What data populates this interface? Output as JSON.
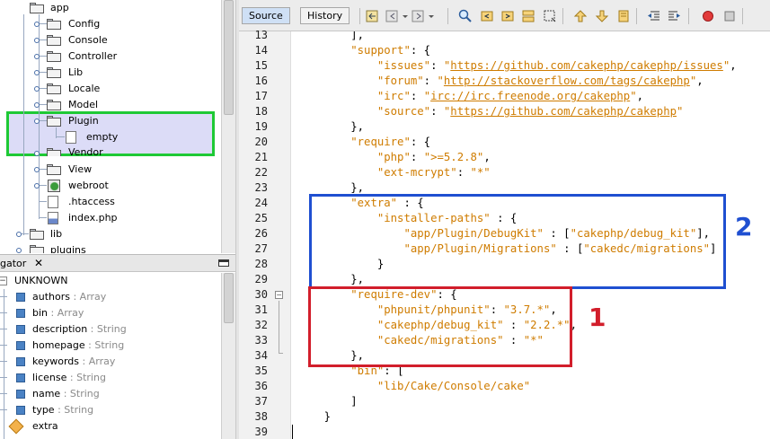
{
  "project_tree": {
    "items": [
      {
        "label": "app",
        "kind": "folder"
      },
      {
        "label": "Config",
        "kind": "folder"
      },
      {
        "label": "Console",
        "kind": "folder"
      },
      {
        "label": "Controller",
        "kind": "folder"
      },
      {
        "label": "Lib",
        "kind": "folder"
      },
      {
        "label": "Locale",
        "kind": "folder"
      },
      {
        "label": "Model",
        "kind": "folder"
      },
      {
        "label": "Plugin",
        "kind": "folder"
      },
      {
        "label": "empty",
        "kind": "file"
      },
      {
        "label": "Vendor",
        "kind": "folder"
      },
      {
        "label": "View",
        "kind": "folder"
      },
      {
        "label": "webroot",
        "kind": "folder"
      },
      {
        "label": ".htaccess",
        "kind": "file"
      },
      {
        "label": "index.php",
        "kind": "php-file"
      },
      {
        "label": "lib",
        "kind": "folder"
      },
      {
        "label": "plugins",
        "kind": "folder"
      }
    ]
  },
  "navigator": {
    "tab_label": "gator",
    "close_glyph": "✕",
    "root_label": "UNKNOWN",
    "items": [
      {
        "name": "authors",
        "type": " : Array"
      },
      {
        "name": "bin",
        "type": " : Array"
      },
      {
        "name": "description",
        "type": " : String"
      },
      {
        "name": "homepage",
        "type": " : String"
      },
      {
        "name": "keywords",
        "type": " : Array"
      },
      {
        "name": "license",
        "type": " : String"
      },
      {
        "name": "name",
        "type": " : String"
      },
      {
        "name": "type",
        "type": " : String"
      },
      {
        "name": "extra",
        "type": ""
      }
    ]
  },
  "editor": {
    "tabs": {
      "source": "Source",
      "history": "History"
    },
    "line_numbers": [
      "13",
      "14",
      "15",
      "16",
      "17",
      "18",
      "19",
      "20",
      "21",
      "22",
      "23",
      "24",
      "25",
      "26",
      "27",
      "28",
      "29",
      "30",
      "31",
      "32",
      "33",
      "34",
      "35",
      "36",
      "37",
      "38",
      "39"
    ],
    "lines": [
      "        ],",
      "        \"support\": {",
      "            \"issues\": \"https://github.com/cakephp/cakephp/issues\",",
      "            \"forum\": \"http://stackoverflow.com/tags/cakephp\",",
      "            \"irc\": \"irc://irc.freenode.org/cakephp\",",
      "            \"source\": \"https://github.com/cakephp/cakephp\"",
      "        },",
      "        \"require\": {",
      "            \"php\": \">=5.2.8\",",
      "            \"ext-mcrypt\": \"*\"",
      "        },",
      "        \"extra\" : {",
      "            \"installer-paths\" : {",
      "                \"app/Plugin/DebugKit\" : [\"cakephp/debug_kit\"],",
      "                \"app/Plugin/Migrations\" : [\"cakedc/migrations\"]",
      "            }",
      "        },",
      "        \"require-dev\": {",
      "            \"phpunit/phpunit\": \"3.7.*\",",
      "            \"cakephp/debug_kit\" : \"2.2.*\",",
      "            \"cakedc/migrations\" : \"*\"",
      "        },",
      "        \"bin\": [",
      "            \"lib/Cake/Console/cake\"",
      "        ]",
      "    }",
      ""
    ]
  },
  "annotations": {
    "label_1": "1",
    "label_2": "2",
    "color_red": "#d21e2b",
    "color_blue": "#1f4fd1",
    "color_green": "#1ec935"
  }
}
